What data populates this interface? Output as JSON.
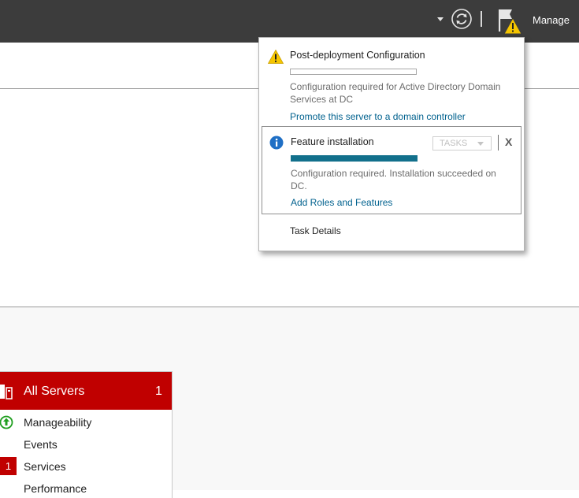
{
  "topbar": {
    "manage_label": "Manage",
    "icons": [
      "chevron-down-icon",
      "refresh-icon",
      "flag-icon",
      "warning-icon"
    ]
  },
  "notifications": [
    {
      "title": "Post-deployment Configuration",
      "text": "Configuration required for Active Directory Domain Services at DC",
      "link": "Promote this server to a domain controller",
      "progress": 0,
      "icon": "warning-icon"
    },
    {
      "title": "Feature installation",
      "tasks_label": "TASKS",
      "close_label": "X",
      "text": "Configuration required. Installation succeeded on DC.",
      "link": "Add Roles and Features",
      "progress": 1.0,
      "icon": "info-icon"
    }
  ],
  "task_details_label": "Task Details",
  "servers_tile": {
    "title": "All Servers",
    "count": "1",
    "color": "#c00000",
    "items": [
      {
        "label": "Manageability",
        "status": "ok"
      },
      {
        "label": "Events",
        "status": ""
      },
      {
        "label": "Services",
        "badge": "1"
      },
      {
        "label": "Performance",
        "status": ""
      }
    ]
  },
  "colors": {
    "topbar": "#3c3c3c",
    "accent_red": "#c00000",
    "link": "#00618e",
    "progress": "#12708c",
    "warning": "#f5c500",
    "info": "#1f6fc5"
  }
}
